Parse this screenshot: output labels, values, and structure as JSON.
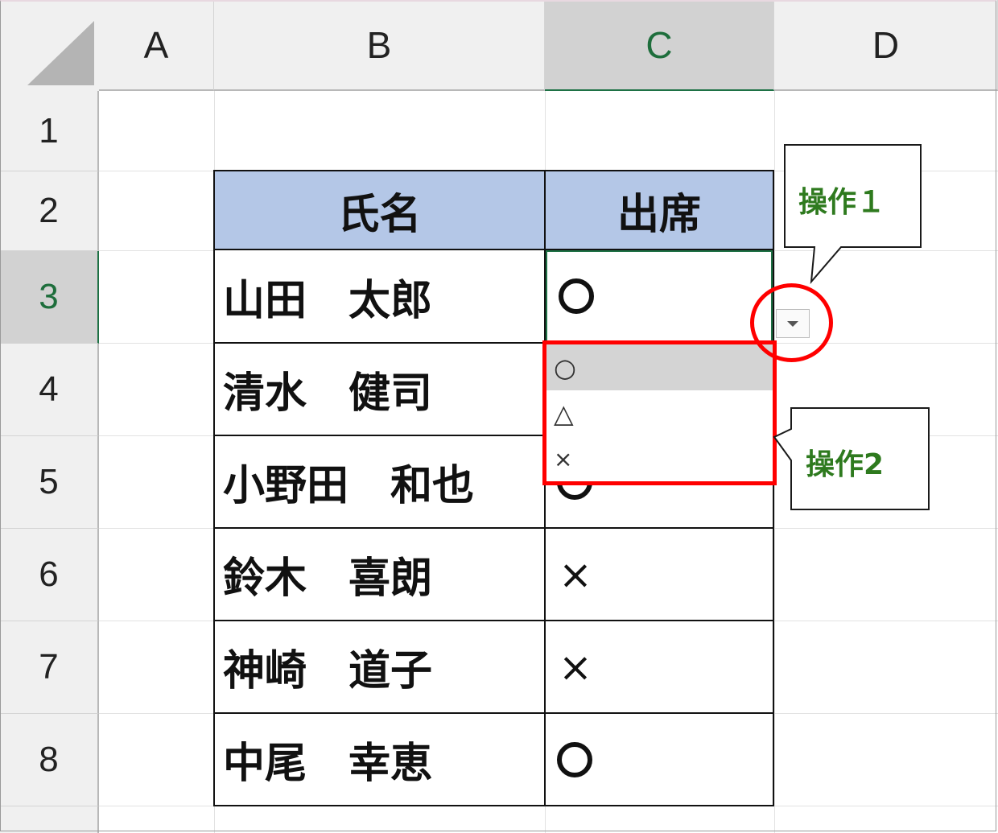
{
  "columns": [
    "A",
    "B",
    "C",
    "D"
  ],
  "selected_column": "C",
  "rows": [
    "1",
    "2",
    "3",
    "4",
    "5",
    "6",
    "7",
    "8"
  ],
  "selected_row": "3",
  "table": {
    "headers": [
      "氏名",
      "出席"
    ],
    "rows": [
      {
        "name": "山田　太郎",
        "attendance": "〇"
      },
      {
        "name": "清水　健司",
        "attendance": ""
      },
      {
        "name": "小野田　和也",
        "attendance": "〇"
      },
      {
        "name": "鈴木　喜朗",
        "attendance": "×"
      },
      {
        "name": "神崎　道子",
        "attendance": "×"
      },
      {
        "name": "中尾　幸恵",
        "attendance": "〇"
      }
    ],
    "header_color": "#b4c7e7"
  },
  "dropdown": {
    "options": [
      "○",
      "△",
      "×"
    ],
    "highlighted_index": 0
  },
  "annotations": {
    "callout_1": "操作１",
    "callout_2": "操作2",
    "highlight_color": "#ff0000",
    "callout_text_color": "#2e7a1e"
  },
  "icons": {
    "dropdown_button": "chevron-down-icon",
    "corner": "select-all-triangle-icon"
  }
}
